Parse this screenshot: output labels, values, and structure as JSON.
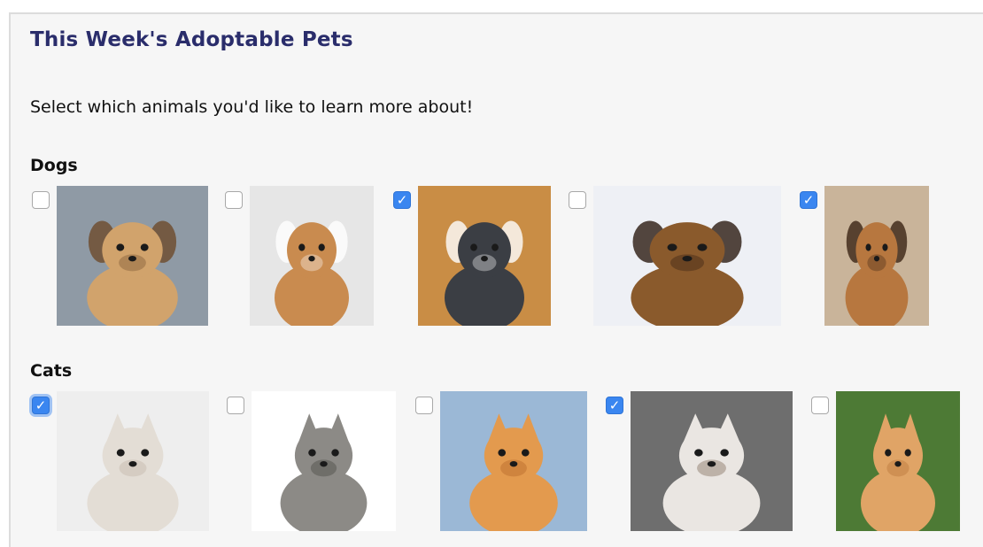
{
  "page": {
    "title": "This Week's Adoptable Pets",
    "subtitle": "Select which animals you'd like to learn more about!"
  },
  "sections": [
    {
      "label": "Dogs",
      "pets": [
        {
          "icon": "pomeranian-photo",
          "checked": false,
          "colors": {
            "bg": "#8f9aa5",
            "fur": "#d1a36c",
            "dark": "#6d4a2a"
          }
        },
        {
          "icon": "corgi-puppy-photo",
          "checked": false,
          "colors": {
            "bg": "#e6e6e6",
            "fur": "#c98b4f",
            "dark": "#ffffff"
          }
        },
        {
          "icon": "husky-puppy-photo",
          "checked": true,
          "colors": {
            "bg": "#c98d45",
            "fur": "#3b3e44",
            "dark": "#ffffff"
          }
        },
        {
          "icon": "beagle-puppy-photo",
          "checked": false,
          "colors": {
            "bg": "#eef0f5",
            "fur": "#8a5a2c",
            "dark": "#2a1a10"
          }
        },
        {
          "icon": "dachshund-puppy-photo",
          "checked": true,
          "colors": {
            "bg": "#c9b49a",
            "fur": "#b7773f",
            "dark": "#3b2414"
          }
        }
      ]
    },
    {
      "label": "Cats",
      "pets": [
        {
          "icon": "fluffy-white-kitten-photo",
          "checked": true,
          "focused": true,
          "colors": {
            "bg": "#eeeeee",
            "fur": "#e3ddd5",
            "dark": "#b9ada1"
          }
        },
        {
          "icon": "tabby-kitten-photo",
          "checked": false,
          "colors": {
            "bg": "#ffffff",
            "fur": "#8c8a86",
            "dark": "#3a3834"
          }
        },
        {
          "icon": "orange-kitten-photo",
          "checked": false,
          "colors": {
            "bg": "#9bb8d6",
            "fur": "#e39a4e",
            "dark": "#a85d22"
          }
        },
        {
          "icon": "ragdoll-cat-photo",
          "checked": true,
          "colors": {
            "bg": "#6e6e6e",
            "fur": "#eae6e2",
            "dark": "#6b4f3c"
          }
        },
        {
          "icon": "ginger-kitten-grass-photo",
          "checked": false,
          "colors": {
            "bg": "#4d7a35",
            "fur": "#e0a466",
            "dark": "#b06c30"
          }
        }
      ]
    }
  ]
}
